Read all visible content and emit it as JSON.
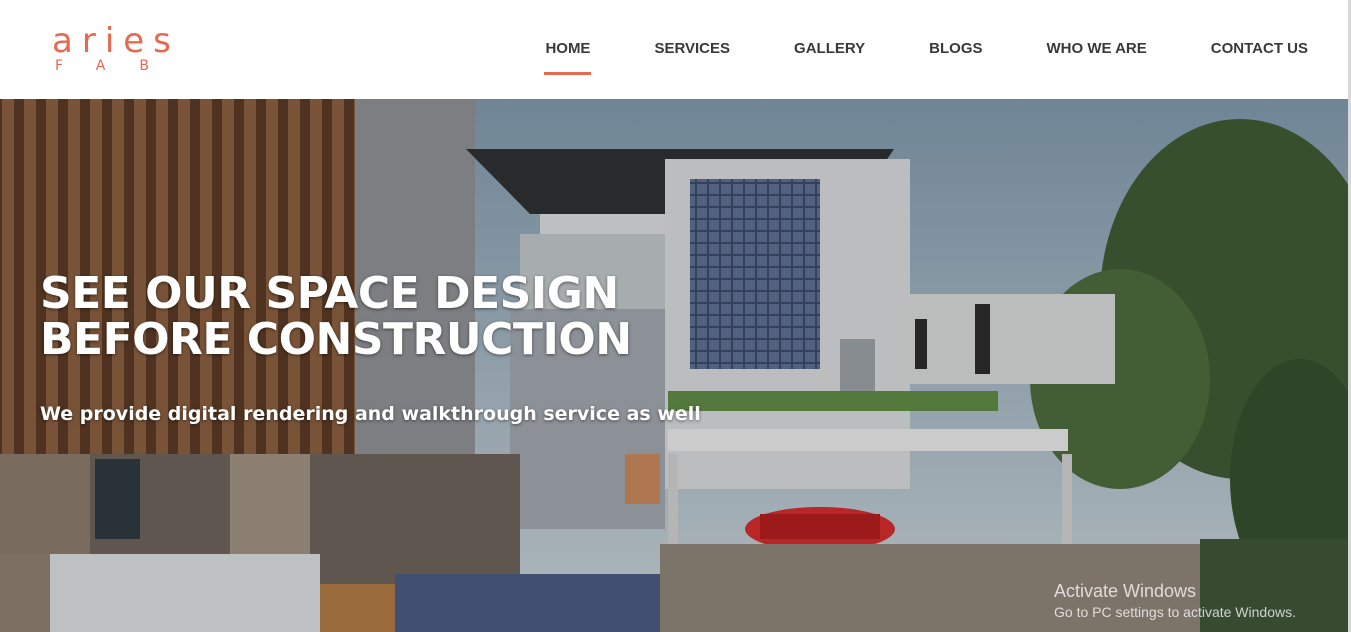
{
  "brand": {
    "logo_top": "aries",
    "logo_bottom": "FAB",
    "accent": "#e66a4f"
  },
  "nav": {
    "items": [
      {
        "label": "HOME",
        "active": true
      },
      {
        "label": "SERVICES"
      },
      {
        "label": "GALLERY"
      },
      {
        "label": "BLOGS"
      },
      {
        "label": "WHO WE ARE"
      },
      {
        "label": "CONTACT US"
      }
    ]
  },
  "hero": {
    "title_line1": "SEE OUR SPACE DESIGN",
    "title_line2": "BEFORE CONSTRUCTION",
    "subtitle": "We provide digital rendering and walkthrough service as well"
  },
  "watermark": {
    "title": "Activate Windows",
    "subtitle": "Go to PC settings to activate Windows."
  }
}
